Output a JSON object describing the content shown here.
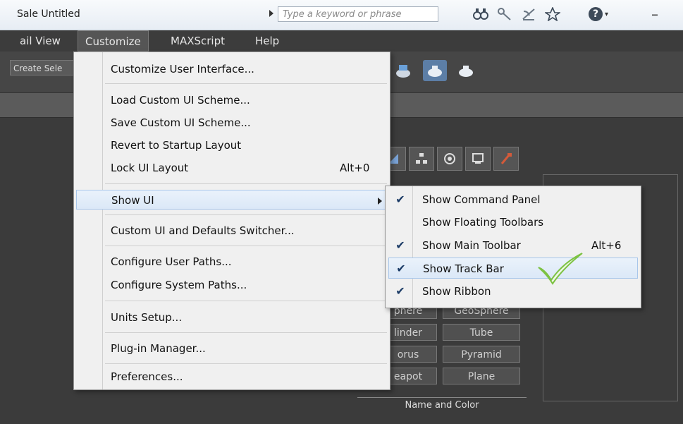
{
  "titlebar": {
    "title": "Sale   Untitled",
    "search_placeholder": "Type a keyword or phrase",
    "icons": [
      "binoculars-icon",
      "key-icon",
      "satellite-icon",
      "star-icon",
      "help-icon",
      "minimize-icon"
    ]
  },
  "menubar": {
    "items": [
      {
        "label": "ail View"
      },
      {
        "label": "Customize"
      },
      {
        "label": "MAXScript"
      },
      {
        "label": "Help"
      }
    ]
  },
  "toolbar": {
    "create_selection": "Create Sele"
  },
  "customize_menu": {
    "items": [
      {
        "label": "Customize User Interface...",
        "shortcut": ""
      },
      {
        "label": "Load Custom UI Scheme...",
        "shortcut": ""
      },
      {
        "label": "Save Custom UI Scheme...",
        "shortcut": ""
      },
      {
        "label": "Revert to Startup Layout",
        "shortcut": ""
      },
      {
        "label": "Lock UI Layout",
        "shortcut": "Alt+0"
      },
      {
        "label": "Show UI",
        "shortcut": ""
      },
      {
        "label": "Custom UI and Defaults Switcher...",
        "shortcut": ""
      },
      {
        "label": "Configure User Paths...",
        "shortcut": ""
      },
      {
        "label": "Configure System Paths...",
        "shortcut": ""
      },
      {
        "label": "Units Setup...",
        "shortcut": ""
      },
      {
        "label": "Plug-in Manager...",
        "shortcut": ""
      },
      {
        "label": "Preferences...",
        "shortcut": ""
      }
    ]
  },
  "show_ui_submenu": {
    "items": [
      {
        "label": "Show Command Panel",
        "checked": true,
        "shortcut": ""
      },
      {
        "label": "Show Floating Toolbars",
        "checked": false,
        "shortcut": ""
      },
      {
        "label": "Show Main Toolbar",
        "checked": true,
        "shortcut": "Alt+6"
      },
      {
        "label": "Show Track Bar",
        "checked": true,
        "shortcut": ""
      },
      {
        "label": "Show Ribbon",
        "checked": true,
        "shortcut": ""
      }
    ]
  },
  "object_type_buttons": {
    "sphere": "phere",
    "geosphere": "GeoSphere",
    "cylinder": "linder",
    "tube": "Tube",
    "torus": "orus",
    "pyramid": "Pyramid",
    "teapot": "eapot",
    "plane": "Plane"
  },
  "name_and_color": "Name and Color",
  "colors": {
    "menu_highlight": "#dbe8f7",
    "menu_highlight_border": "#a8c6ea",
    "app_dark": "#3b3b3b",
    "checkmark_green": "#7cc242"
  }
}
